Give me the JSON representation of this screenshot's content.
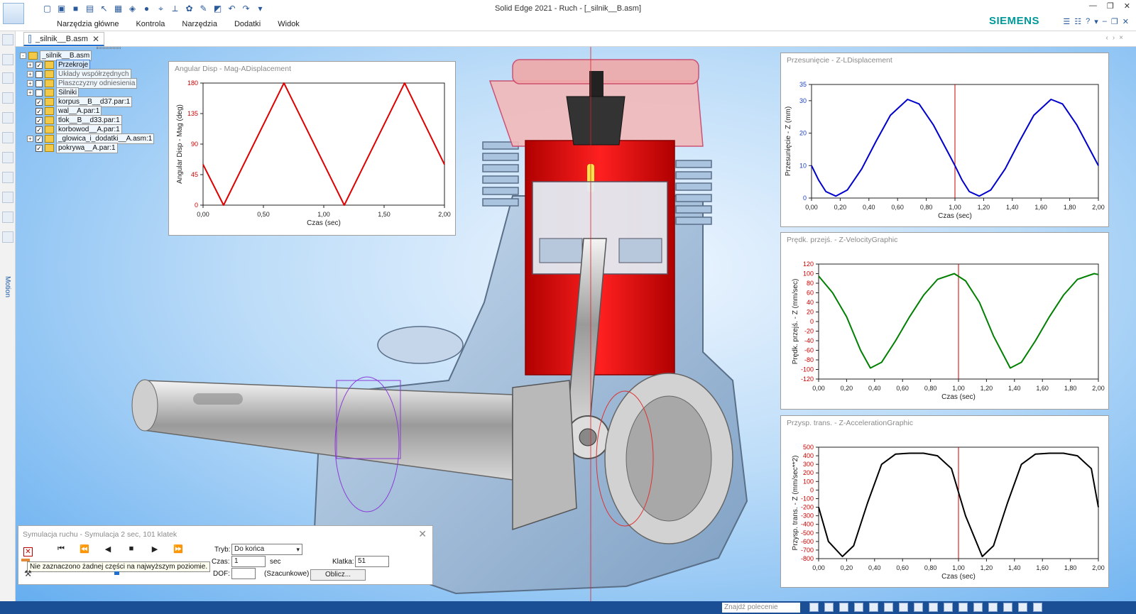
{
  "window": {
    "title": "Solid Edge 2021 - Ruch - [_silnik__B.asm]",
    "brand": "SIEMENS",
    "ribbon_tabs": [
      "Narzędzia główne",
      "Kontrola",
      "Narzędzia",
      "Dodatki",
      "Widok"
    ],
    "doc_tab": "_silnik__B.asm",
    "left_panel_label": "Motion"
  },
  "tree": {
    "items": [
      {
        "label": "_silnik__B.asm",
        "checked": false,
        "expander": "-",
        "indent": 0,
        "style": "root"
      },
      {
        "label": "Przekroje",
        "checked": true,
        "expander": "+",
        "indent": 1,
        "style": "sel"
      },
      {
        "label": "Układy współrzędnych",
        "checked": false,
        "expander": "+",
        "indent": 1,
        "style": "grey"
      },
      {
        "label": "Płaszczyzny odniesienia",
        "checked": false,
        "expander": "+",
        "indent": 1,
        "style": "grey"
      },
      {
        "label": "Silniki",
        "checked": false,
        "expander": "+",
        "indent": 1,
        "style": "normal"
      },
      {
        "label": "korpus__B__d37.par:1",
        "checked": true,
        "expander": "",
        "indent": 1,
        "style": "normal"
      },
      {
        "label": "wal__A.par:1",
        "checked": true,
        "expander": "",
        "indent": 1,
        "style": "normal"
      },
      {
        "label": "tlok__B__d33.par:1",
        "checked": true,
        "expander": "",
        "indent": 1,
        "style": "normal"
      },
      {
        "label": "korbowod__A.par:1",
        "checked": true,
        "expander": "",
        "indent": 1,
        "style": "normal"
      },
      {
        "label": "_glowica_i_dodatki__A.asm:1",
        "checked": true,
        "expander": "+",
        "indent": 1,
        "style": "normal"
      },
      {
        "label": "pokrywa__A.par:1",
        "checked": true,
        "expander": "",
        "indent": 1,
        "style": "normal"
      }
    ]
  },
  "chart_data": [
    {
      "id": "angular",
      "type": "line",
      "title": "Angular Disp - Mag-ADisplacement",
      "xlabel": "Czas (sec)",
      "ylabel": "Angular Disp - Mag (deg)",
      "xlim": [
        0,
        2
      ],
      "ylim": [
        0,
        180
      ],
      "xticks": [
        "0,00",
        "0,50",
        "1,00",
        "1,50",
        "2,00"
      ],
      "xtick_values": [
        0,
        0.5,
        1,
        1.5,
        2
      ],
      "yticks": [
        "0",
        "45",
        "90",
        "135",
        "180"
      ],
      "ytick_values": [
        0,
        45,
        90,
        135,
        180
      ],
      "tick_color": "#cc0000",
      "cursor_x": null,
      "series": [
        {
          "color": "#e00000",
          "x": [
            0,
            0.17,
            0.67,
            1.17,
            1.67,
            2.0
          ],
          "y": [
            60,
            0,
            180,
            0,
            180,
            60
          ]
        }
      ]
    },
    {
      "id": "displacement",
      "type": "line",
      "title": "Przesunięcie - Z-LDisplacement",
      "xlabel": "Czas (sec)",
      "ylabel": "Przesunięcie - Z (mm)",
      "xlim": [
        0,
        2
      ],
      "ylim": [
        0,
        35
      ],
      "xticks": [
        "0,00",
        "0,20",
        "0,40",
        "0,60",
        "0,80",
        "1,00",
        "1,20",
        "1,40",
        "1,60",
        "1,80",
        "2,00"
      ],
      "xtick_values": [
        0,
        0.2,
        0.4,
        0.6,
        0.8,
        1.0,
        1.2,
        1.4,
        1.6,
        1.8,
        2.0
      ],
      "yticks": [
        "0",
        "10",
        "20",
        "30",
        "35"
      ],
      "ytick_values": [
        0,
        10,
        20,
        30,
        35
      ],
      "tick_color": "#1a3fbf",
      "cursor_x": 1.0,
      "series": [
        {
          "color": "#0000cc",
          "x": [
            0,
            0.05,
            0.1,
            0.17,
            0.25,
            0.35,
            0.45,
            0.55,
            0.67,
            0.75,
            0.85,
            0.95,
            1.0,
            1.05,
            1.1,
            1.17,
            1.25,
            1.35,
            1.45,
            1.55,
            1.67,
            1.75,
            1.85,
            1.95,
            2.0
          ],
          "y": [
            10,
            5.5,
            2,
            0.6,
            2.5,
            9,
            17.5,
            25.5,
            30.4,
            29,
            22.5,
            14.2,
            10,
            5.5,
            2,
            0.6,
            2.5,
            9,
            17.5,
            25.5,
            30.4,
            29,
            22.5,
            14.2,
            10
          ]
        }
      ]
    },
    {
      "id": "velocity",
      "type": "line",
      "title": "Prędk. przejś. - Z-VelocityGraphic",
      "xlabel": "Czas (sec)",
      "ylabel": "Prędk. przejś. - Z (mm/sec)",
      "xlim": [
        0,
        2
      ],
      "ylim": [
        -120,
        120
      ],
      "xticks": [
        "0,00",
        "0,20",
        "0,40",
        "0,60",
        "0,80",
        "1,00",
        "1,20",
        "1,40",
        "1,60",
        "1,80",
        "2,00"
      ],
      "xtick_values": [
        0,
        0.2,
        0.4,
        0.6,
        0.8,
        1.0,
        1.2,
        1.4,
        1.6,
        1.8,
        2.0
      ],
      "yticks": [
        "120",
        "100",
        "80",
        "60",
        "40",
        "20",
        "0",
        "-20",
        "-40",
        "-60",
        "-80",
        "-100",
        "-120"
      ],
      "ytick_values": [
        120,
        100,
        80,
        60,
        40,
        20,
        0,
        -20,
        -40,
        -60,
        -80,
        -100,
        -120
      ],
      "tick_color": "#cc0000",
      "cursor_x": 1.0,
      "series": [
        {
          "color": "#008000",
          "x": [
            0,
            0.1,
            0.2,
            0.3,
            0.37,
            0.45,
            0.55,
            0.65,
            0.75,
            0.85,
            0.97,
            1.05,
            1.15,
            1.25,
            1.37,
            1.45,
            1.55,
            1.65,
            1.75,
            1.85,
            1.97,
            2.0
          ],
          "y": [
            95,
            60,
            10,
            -60,
            -97,
            -85,
            -40,
            10,
            55,
            88,
            100,
            85,
            40,
            -30,
            -97,
            -85,
            -40,
            10,
            55,
            88,
            100,
            98
          ]
        }
      ]
    },
    {
      "id": "acceleration",
      "type": "line",
      "title": "Przysp. trans. - Z-AccelerationGraphic",
      "xlabel": "Czas (sec)",
      "ylabel": "Przysp. trans. - Z (mm/sec**2)",
      "xlim": [
        0,
        2
      ],
      "ylim": [
        -800,
        500
      ],
      "xticks": [
        "0,00",
        "0,20",
        "0,40",
        "0,60",
        "0,80",
        "1,00",
        "1,20",
        "1,40",
        "1,60",
        "1,80",
        "2,00"
      ],
      "xtick_values": [
        0,
        0.2,
        0.4,
        0.6,
        0.8,
        1.0,
        1.2,
        1.4,
        1.6,
        1.8,
        2.0
      ],
      "yticks": [
        "500",
        "400",
        "300",
        "200",
        "100",
        "0",
        "-100",
        "-200",
        "-300",
        "-400",
        "-500",
        "-600",
        "-700",
        "-800"
      ],
      "ytick_values": [
        500,
        400,
        300,
        200,
        100,
        0,
        -100,
        -200,
        -300,
        -400,
        -500,
        -600,
        -700,
        -800
      ],
      "tick_color": "#cc0000",
      "cursor_x": 1.0,
      "series": [
        {
          "color": "#000000",
          "x": [
            0,
            0.07,
            0.17,
            0.25,
            0.35,
            0.45,
            0.55,
            0.65,
            0.75,
            0.85,
            0.95,
            1.05,
            1.17,
            1.25,
            1.35,
            1.45,
            1.55,
            1.65,
            1.75,
            1.85,
            1.95,
            2.0
          ],
          "y": [
            -200,
            -600,
            -775,
            -650,
            -150,
            300,
            420,
            430,
            430,
            400,
            250,
            -300,
            -775,
            -650,
            -150,
            300,
            420,
            430,
            430,
            400,
            250,
            -200
          ]
        }
      ]
    }
  ],
  "sim": {
    "title": "Symulacja ruchu - Symulacja 2 sec, 101 klatek",
    "tooltip": "Nie zaznaczono żadnej części na najwyższym poziomie.",
    "controls": [
      "⏮",
      "⏪",
      "◀",
      "■",
      "▶",
      "⏩"
    ],
    "mode_label": "Tryb:",
    "mode_value": "Do końca",
    "time_label": "Czas:",
    "time_value": "1",
    "time_unit": "sec",
    "frame_label": "Klatka:",
    "frame_value": "51",
    "dof_label": "DOF:",
    "dof_value": "",
    "estimate_label": "(Szacunkowe)",
    "compute_label": "Oblicz..."
  },
  "status": {
    "search_placeholder": "Znajdź polecenie"
  }
}
